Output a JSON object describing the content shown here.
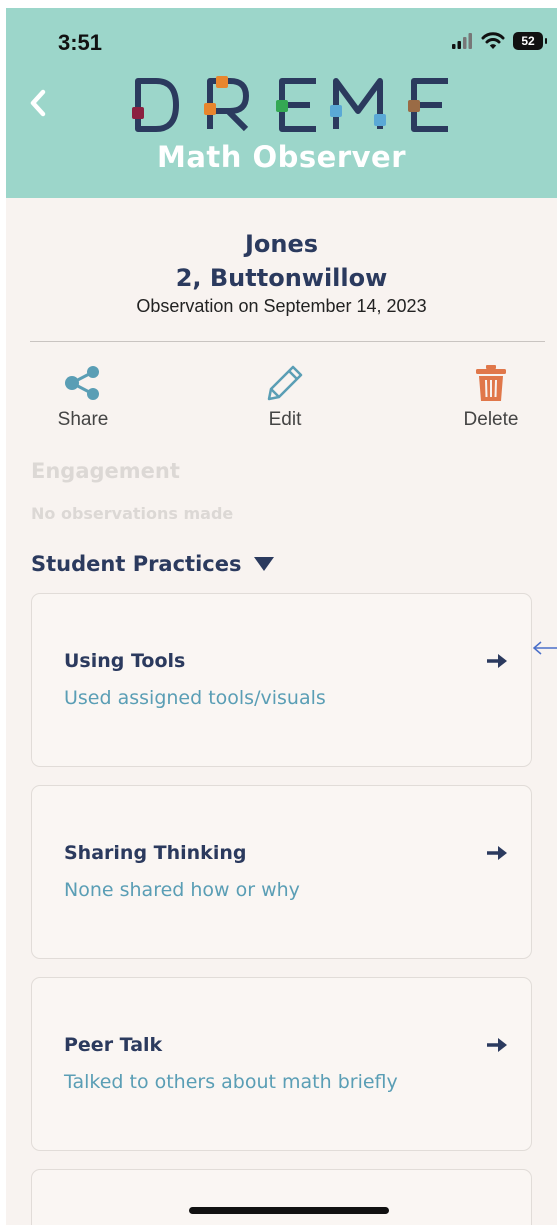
{
  "status_bar": {
    "time": "3:51",
    "battery": "52"
  },
  "header": {
    "logo_letters": [
      "D",
      "R",
      "E",
      "M",
      "E"
    ],
    "subtitle": "Math Observer"
  },
  "observation": {
    "name": "Jones",
    "class": "2, Buttonwillow",
    "date": "Observation on September 14, 2023"
  },
  "actions": {
    "share": "Share",
    "edit": "Edit",
    "delete": "Delete"
  },
  "engagement": {
    "heading": "Engagement",
    "status": "No observations made"
  },
  "student_practices": {
    "heading": "Student Practices",
    "items": [
      {
        "title": "Using Tools",
        "description": "Used assigned tools/visuals"
      },
      {
        "title": "Sharing Thinking",
        "description": "None shared how or why"
      },
      {
        "title": "Peer Talk",
        "description": "Talked to others about math briefly"
      }
    ]
  },
  "colors": {
    "header_bg": "#9cd6ca",
    "navy": "#2b3a5e",
    "teal_text": "#5a9eb5",
    "delete_orange": "#e0774a"
  }
}
